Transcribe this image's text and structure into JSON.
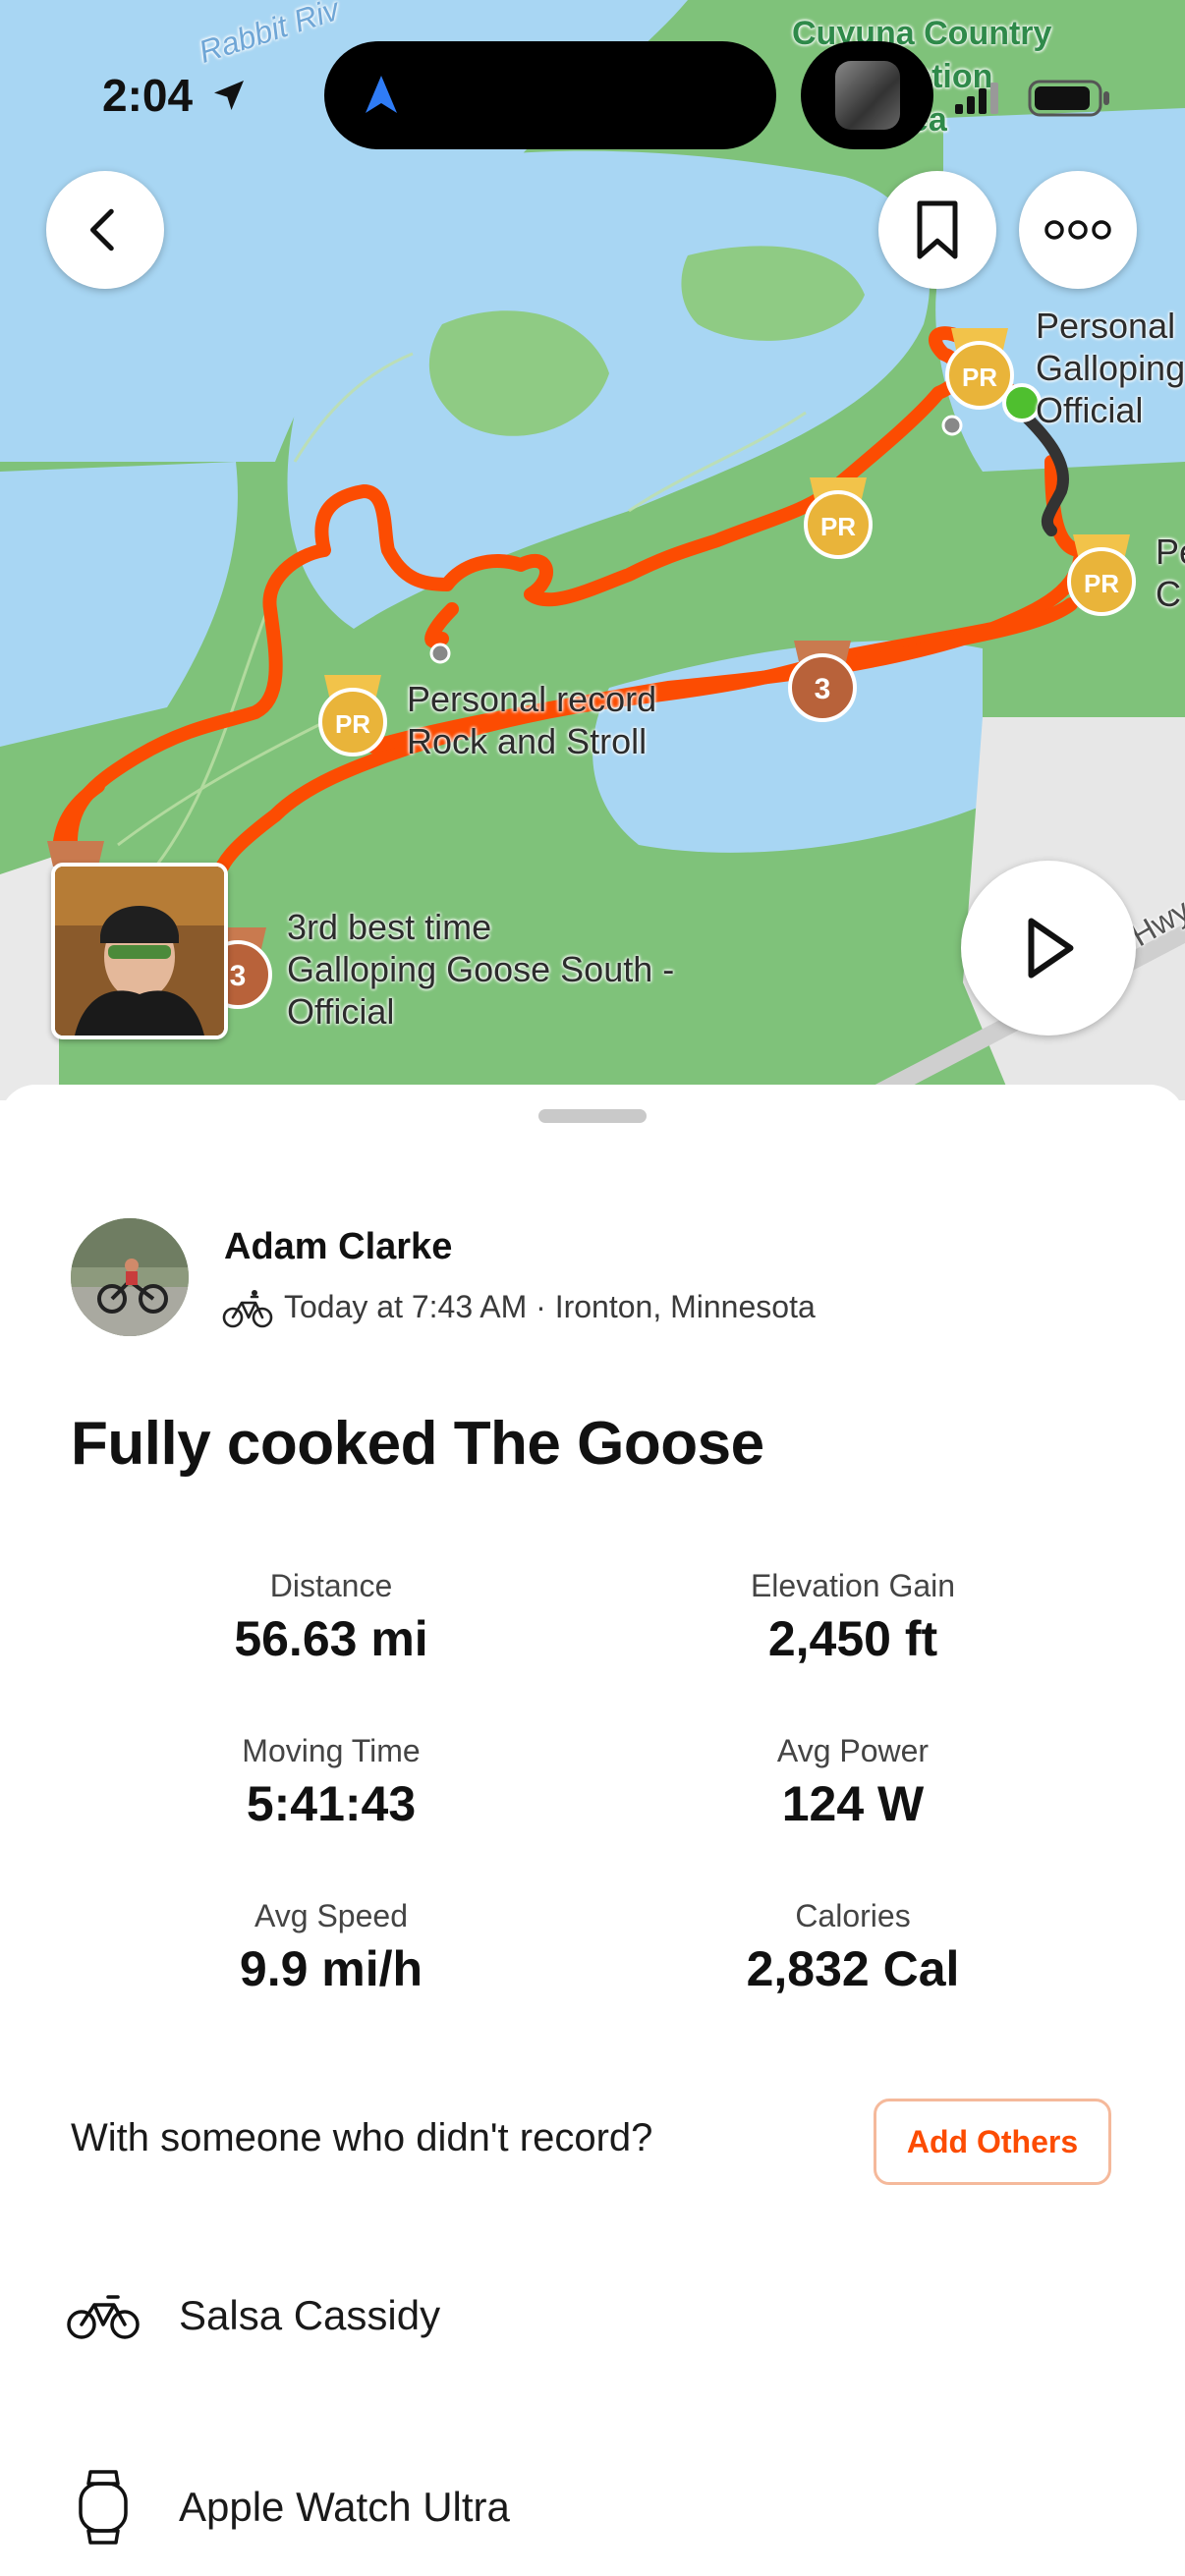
{
  "status_bar": {
    "time": "2:04"
  },
  "map": {
    "labels": {
      "rabbit": "Rabbit Riv",
      "cuyuna_1": "Cuyuna Country",
      "cuyuna_2": "S      creation",
      "cuyuna_3": "ea",
      "top_right_1": "Personal",
      "top_right_2": "Galloping",
      "top_right_3": "Official",
      "right_edge_1": "Pe",
      "right_edge_2": "C",
      "pr_rock_1": "Personal record",
      "pr_rock_2": "Rock and Stroll",
      "third_1": "3rd best time",
      "third_2": "Galloping Goose South -",
      "third_3": "Official",
      "hwy": "Hwy"
    },
    "badges": {
      "pr": "PR",
      "third": "3"
    }
  },
  "activity": {
    "athlete_name": "Adam Clarke",
    "meta": "Today at 7:43 AM · Ironton, Minnesota",
    "title": "Fully cooked The Goose",
    "stats": [
      {
        "label": "Distance",
        "value": "56.63 mi"
      },
      {
        "label": "Elevation Gain",
        "value": "2,450 ft"
      },
      {
        "label": "Moving Time",
        "value": "5:41:43"
      },
      {
        "label": "Avg Power",
        "value": "124 W"
      },
      {
        "label": "Avg Speed",
        "value": "9.9 mi/h"
      },
      {
        "label": "Calories",
        "value": "2,832 Cal"
      }
    ],
    "with_others_prompt": "With someone who didn't record?",
    "add_others_label": "Add Others",
    "gear": [
      {
        "icon": "bike-icon",
        "name": "Salsa Cassidy"
      },
      {
        "icon": "watch-icon",
        "name": "Apple Watch Ultra"
      }
    ]
  },
  "colors": {
    "route": "#fc4c02",
    "water": "#a8d6f3",
    "land": "#7fc27a",
    "pr_gold": "#e9b43a",
    "third_bronze": "#b8623a",
    "accent": "#fc4c02"
  }
}
